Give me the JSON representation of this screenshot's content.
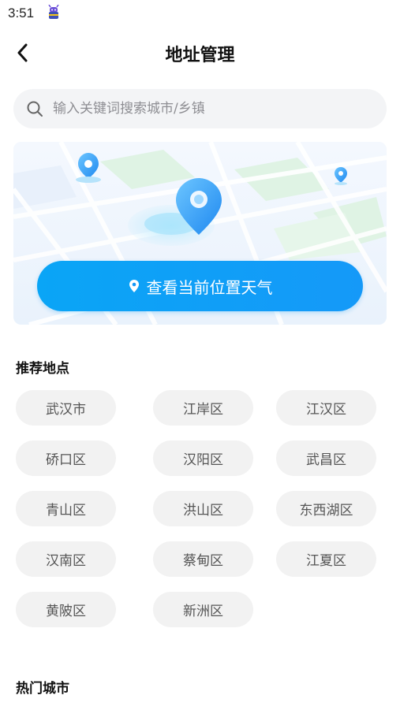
{
  "status_bar": {
    "time": "3:51",
    "notification_icon": "android-bug-icon"
  },
  "nav": {
    "title": "地址管理",
    "back_icon": "chevron-left-icon"
  },
  "search": {
    "placeholder": "输入关键词搜索城市/乡镇",
    "value": ""
  },
  "map_card": {
    "button_label": "查看当前位置天气",
    "button_icon": "location-pin-icon"
  },
  "recommended": {
    "title": "推荐地点",
    "items": [
      "武汉市",
      "江岸区",
      "江汉区",
      "硚口区",
      "汉阳区",
      "武昌区",
      "青山区",
      "洪山区",
      "东西湖区",
      "汉南区",
      "蔡甸区",
      "江夏区",
      "黄陂区",
      "新洲区"
    ]
  },
  "hot_cities": {
    "title": "热门城市"
  },
  "colors": {
    "accent": "#0aa5f6",
    "chip_bg": "#f2f2f2",
    "search_bg": "#f3f4f6"
  }
}
